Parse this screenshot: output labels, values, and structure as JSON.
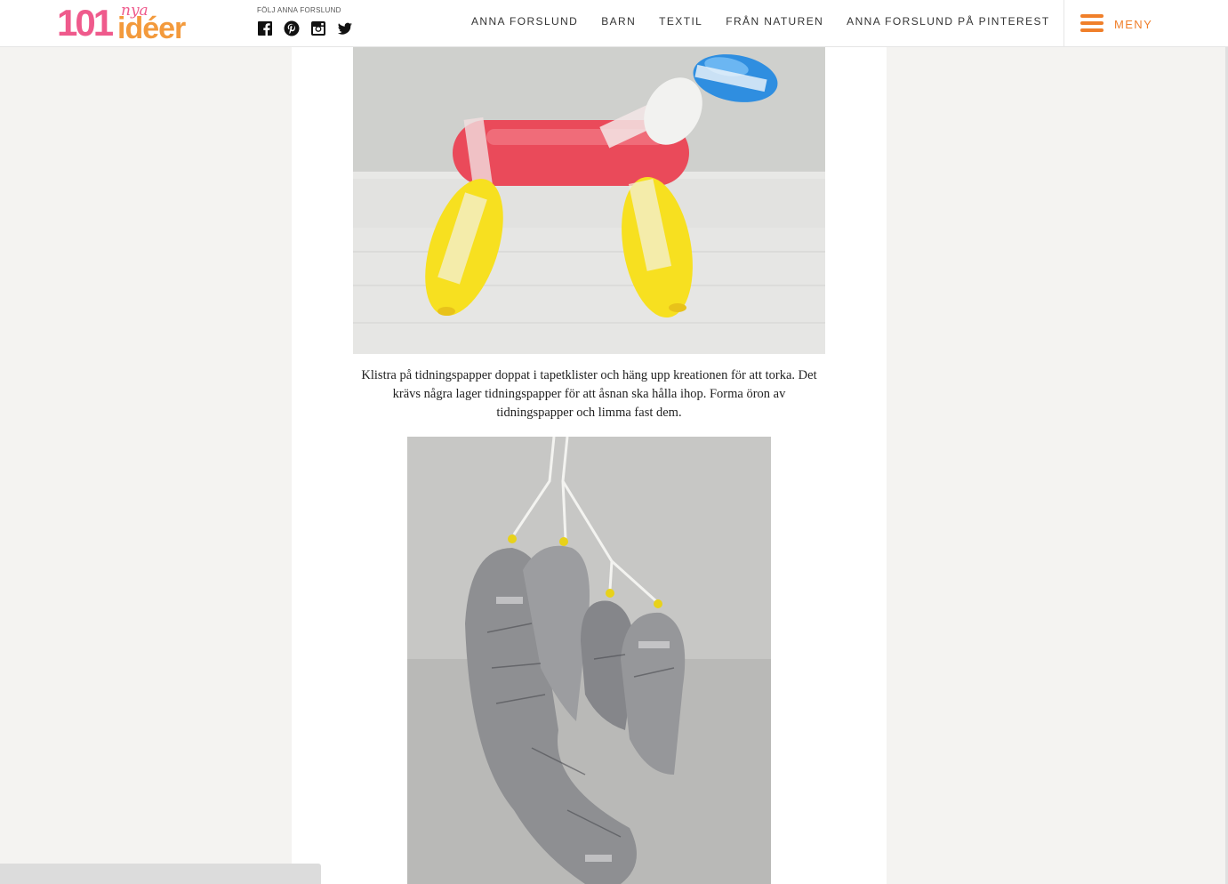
{
  "logo": {
    "number": "101",
    "nya": "nya",
    "ideer": "idéer"
  },
  "follow": {
    "label": "FÖLJ ANNA FORSLUND",
    "icons": [
      "facebook-icon",
      "pinterest-icon",
      "instagram-icon",
      "twitter-icon"
    ]
  },
  "nav": {
    "items": [
      "ANNA FORSLUND",
      "BARN",
      "TEXTIL",
      "FRÅN NATUREN",
      "ANNA FORSLUND PÅ PINTEREST"
    ]
  },
  "menu": {
    "label": "MENY"
  },
  "article": {
    "caption": "Klistra på tidningspapper doppat i tapetklister och häng upp kreationen för att torka. Det krävs några lager tidningspapper för att åsnan ska hålla ihop. Forma öron av tidningspapper och limma fast dem."
  },
  "colors": {
    "logo_pink": "#ef5a8c",
    "logo_orange": "#f39a3c",
    "menu_orange": "#f07f2a",
    "page_background": "#f4f3f1"
  }
}
